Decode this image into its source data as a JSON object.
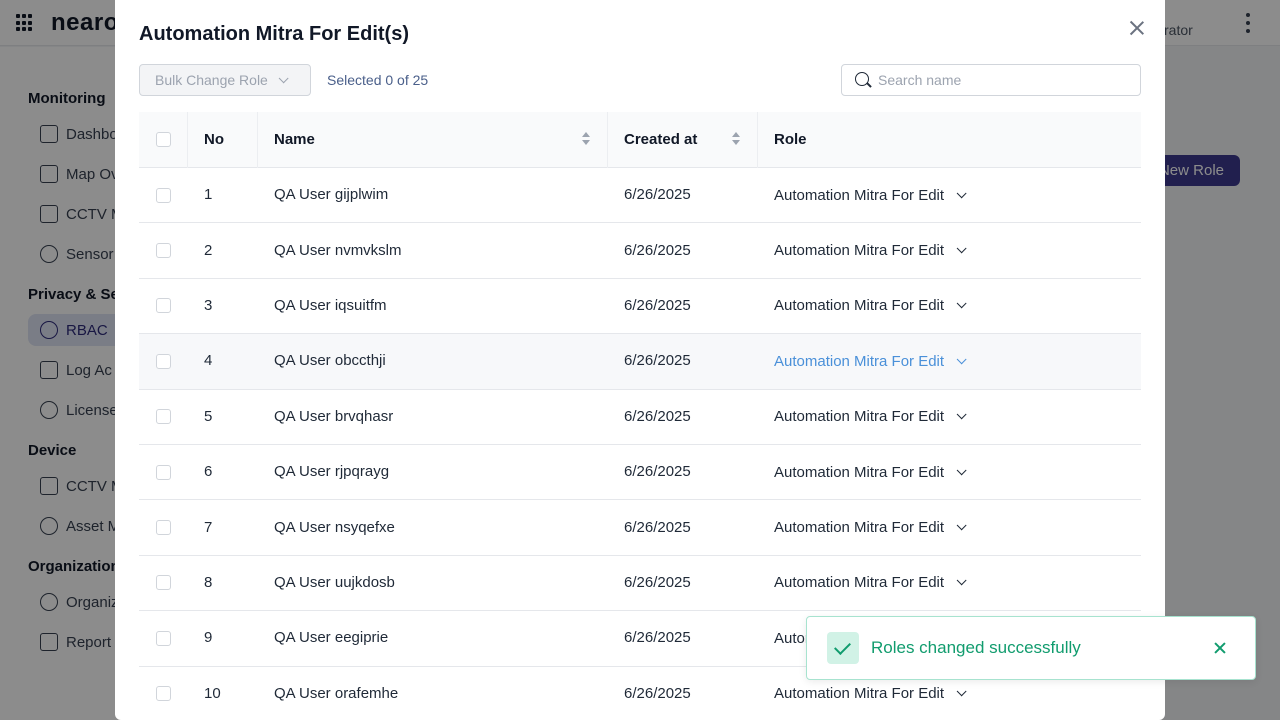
{
  "app": {
    "logo": "nearo",
    "user_role": "istrator"
  },
  "sidebar": {
    "sections": [
      {
        "label": "Monitoring",
        "items": [
          {
            "label": "Dashbo",
            "icon": "monitor-icon"
          },
          {
            "label": "Map Ov",
            "icon": "map-icon"
          },
          {
            "label": "CCTV M",
            "icon": "video-icon"
          },
          {
            "label": "Sensor",
            "icon": "broadcast-icon"
          }
        ]
      },
      {
        "label": "Privacy & Sec",
        "items": [
          {
            "label": "RBAC",
            "icon": "rbac-icon",
            "active": true
          },
          {
            "label": "Log Ac",
            "icon": "clipboard-icon"
          },
          {
            "label": "License",
            "icon": "key-icon"
          }
        ]
      },
      {
        "label": "Device",
        "items": [
          {
            "label": "CCTV M",
            "icon": "grid-icon"
          },
          {
            "label": "Asset M",
            "icon": "database-icon"
          }
        ]
      },
      {
        "label": "Organization",
        "items": [
          {
            "label": "Organiz",
            "icon": "gear-icon"
          },
          {
            "label": "Report",
            "icon": "report-icon"
          }
        ]
      }
    ]
  },
  "page": {
    "new_role_label": "New Role"
  },
  "modal": {
    "title": "Automation Mitra For Edit(s)",
    "bulk_change_label": "Bulk Change Role",
    "selected_text": "Selected 0 of 25",
    "search_placeholder": "Search name",
    "columns": {
      "no": "No",
      "name": "Name",
      "created": "Created at",
      "role": "Role"
    },
    "rows": [
      {
        "no": "1",
        "name": "QA User gijplwim",
        "created": "6/26/2025",
        "role": "Automation Mitra For Edit"
      },
      {
        "no": "2",
        "name": "QA User nvmvkslm",
        "created": "6/26/2025",
        "role": "Automation Mitra For Edit"
      },
      {
        "no": "3",
        "name": "QA User iqsuitfm",
        "created": "6/26/2025",
        "role": "Automation Mitra For Edit"
      },
      {
        "no": "4",
        "name": "QA User obccthji",
        "created": "6/26/2025",
        "role": "Automation Mitra For Edit"
      },
      {
        "no": "5",
        "name": "QA User brvqhasr",
        "created": "6/26/2025",
        "role": "Automation Mitra For Edit"
      },
      {
        "no": "6",
        "name": "QA User rjpqrayg",
        "created": "6/26/2025",
        "role": "Automation Mitra For Edit"
      },
      {
        "no": "7",
        "name": "QA User nsyqefxe",
        "created": "6/26/2025",
        "role": "Automation Mitra For Edit"
      },
      {
        "no": "8",
        "name": "QA User uujkdosb",
        "created": "6/26/2025",
        "role": "Automation Mitra For Edit"
      },
      {
        "no": "9",
        "name": "QA User eegiprie",
        "created": "6/26/2025",
        "role": "Automation Mitra For Edit"
      },
      {
        "no": "10",
        "name": "QA User orafemhe",
        "created": "6/26/2025",
        "role": "Automation Mitra For Edit"
      }
    ]
  },
  "toast": {
    "message": "Roles changed successfully",
    "color": "#119c6e"
  }
}
